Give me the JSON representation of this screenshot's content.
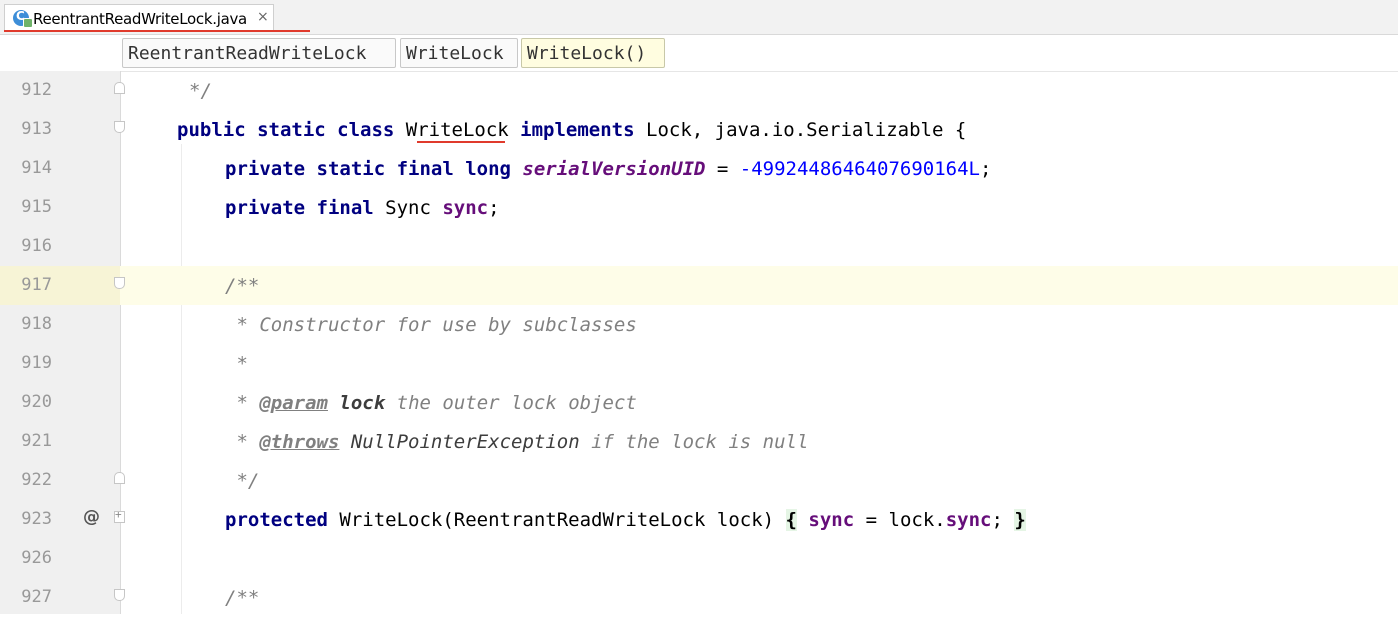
{
  "tab": {
    "file_name": "ReentrantReadWriteLock.java",
    "close_glyph": "×"
  },
  "breadcrumbs": [
    "ReentrantReadWriteLock",
    "WriteLock",
    "WriteLock()"
  ],
  "gutter": {
    "annotation_marker": "@"
  },
  "lines": [
    {
      "num": "912",
      "segments": [
        {
          "t": "*/",
          "c": "cmt"
        }
      ]
    },
    {
      "num": "913",
      "segments": [
        {
          "t": "public static class ",
          "c": "kw"
        },
        {
          "t": "WriteLock "
        },
        {
          "t": "implements ",
          "c": "kw"
        },
        {
          "t": "Lock, java.io.Serializable {"
        }
      ]
    },
    {
      "num": "914",
      "segments": [
        {
          "t": "private static final long ",
          "c": "kw"
        },
        {
          "t": "serialVersionUID",
          "c": "sfield"
        },
        {
          "t": " = "
        },
        {
          "t": "-4992448646407690164L",
          "c": "num"
        },
        {
          "t": ";"
        }
      ]
    },
    {
      "num": "915",
      "segments": [
        {
          "t": "private final ",
          "c": "kw"
        },
        {
          "t": "Sync "
        },
        {
          "t": "sync",
          "c": "field"
        },
        {
          "t": ";"
        }
      ]
    },
    {
      "num": "916",
      "segments": []
    },
    {
      "num": "917",
      "segments": [
        {
          "t": "/**",
          "c": "cmt"
        }
      ]
    },
    {
      "num": "918",
      "segments": [
        {
          "t": " * Constructor for use by subclasses",
          "c": "cmt"
        }
      ]
    },
    {
      "num": "919",
      "segments": [
        {
          "t": " *",
          "c": "cmt"
        }
      ]
    },
    {
      "num": "920",
      "segments": [
        {
          "t": " * ",
          "c": "cmt"
        },
        {
          "t": "@param",
          "c": "tag"
        },
        {
          "t": " "
        },
        {
          "t": "lock",
          "c": "pname"
        },
        {
          "t": " the outer lock object",
          "c": "cmt"
        }
      ]
    },
    {
      "num": "921",
      "segments": [
        {
          "t": " * ",
          "c": "cmt"
        },
        {
          "t": "@throws",
          "c": "tag"
        },
        {
          "t": " "
        },
        {
          "t": "NullPointerException",
          "c": "cref"
        },
        {
          "t": " if the lock is null",
          "c": "cmt"
        }
      ]
    },
    {
      "num": "922",
      "segments": [
        {
          "t": " */",
          "c": "cmt"
        }
      ]
    },
    {
      "num": "923",
      "segments": [
        {
          "t": "protected ",
          "c": "kw"
        },
        {
          "t": "WriteLock(ReentrantReadWriteLock lock) "
        },
        {
          "t": "{",
          "c": "brace"
        },
        {
          "t": " "
        },
        {
          "t": "sync",
          "c": "field"
        },
        {
          "t": " = lock."
        },
        {
          "t": "sync",
          "c": "field"
        },
        {
          "t": "; "
        },
        {
          "t": "}",
          "c": "brace"
        }
      ]
    },
    {
      "num": "926",
      "segments": []
    },
    {
      "num": "927",
      "segments": [
        {
          "t": "/**",
          "c": "cmt"
        }
      ]
    }
  ]
}
